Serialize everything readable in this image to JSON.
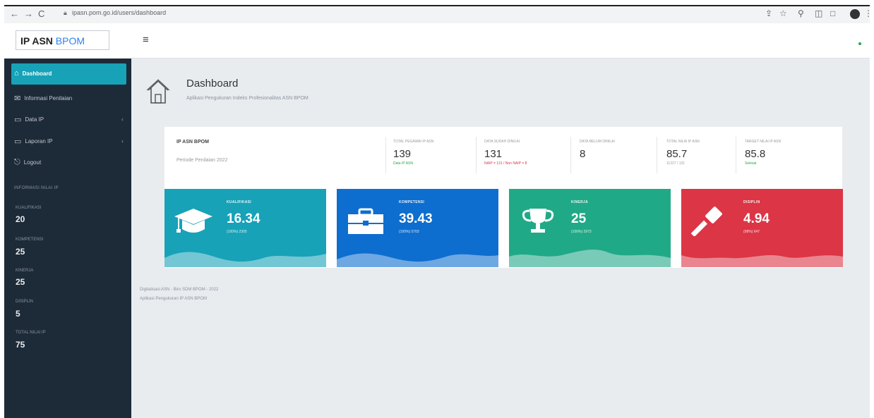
{
  "browser": {
    "url": "ipasn.pom.go.id/users/dashboard"
  },
  "brand": {
    "name_dark": "IP ASN",
    "name_accent": "BPOM"
  },
  "sidebar": {
    "items": [
      {
        "label": "Dashboard",
        "icon": "home-icon",
        "active": true
      },
      {
        "label": "Informasi Penilaian",
        "icon": "mail-icon"
      },
      {
        "label": "Data IP",
        "icon": "folder-icon"
      },
      {
        "label": "Laporan IP",
        "icon": "folder-icon"
      },
      {
        "label": "Logout",
        "icon": "logout-icon"
      }
    ],
    "section_title": "INFORMASI NILAI IP",
    "stats": [
      {
        "label": "KUALIFIKASI",
        "value": "20"
      },
      {
        "label": "KOMPETENSI",
        "value": "25"
      },
      {
        "label": "KINERJA",
        "value": "25"
      },
      {
        "label": "DISIPLIN",
        "value": "5"
      },
      {
        "label": "TOTAL NILAI IP",
        "value": "75"
      }
    ]
  },
  "header": {
    "title": "Dashboard",
    "subtitle": "Aplikasi Pengukuran Indeks Profesionalitas ASN BPOM"
  },
  "summary": {
    "title": "IP ASN BPOM",
    "subtitle": "Periode Penilaian 2022",
    "stats": [
      {
        "label": "TOTAL PEGAWAI IP ASN",
        "value": "139",
        "footer": "Data IP ASN",
        "footer_color": "#28a745"
      },
      {
        "label": "DATA SUDAH DINILAI",
        "value": "131",
        "footer": "NAIP = 131 / Non NAIP = 8",
        "footer_color": "#dc3545"
      },
      {
        "label": "DATA BELUM DINILAI",
        "value": "8",
        "footer": "",
        "footer_color": "#999999"
      },
      {
        "label": "TOTAL NILAI IP ASN",
        "value": "85.7",
        "footer": "11227 / 131",
        "footer_color": "#999999"
      },
      {
        "label": "TARGET NILAI IP ASN",
        "value": "85.8",
        "footer": "Selesai",
        "footer_color": "#28a745"
      }
    ]
  },
  "boxes": [
    {
      "title": "KUALIFIKASI",
      "value": "16.34",
      "sub": "(100%) 2305",
      "color": "#17a2b8",
      "icon": "graduation-cap-icon"
    },
    {
      "title": "KOMPETENSI",
      "value": "39.43",
      "sub": "(100%) 5703",
      "color": "#0d6ecf",
      "icon": "briefcase-icon"
    },
    {
      "title": "KINERJA",
      "value": "25",
      "sub": "(100%) 2973",
      "color": "#20a987",
      "icon": "trophy-icon"
    },
    {
      "title": "DISIPLIN",
      "value": "4.94",
      "sub": "(98%) 647",
      "color": "#dc3545",
      "icon": "gavel-icon"
    }
  ],
  "footer": {
    "line1": "Digitalisasi ASN - Biro SDM BPOM - 2022",
    "line2": "Aplikasi Pengukuran IP ASN BPOM"
  }
}
